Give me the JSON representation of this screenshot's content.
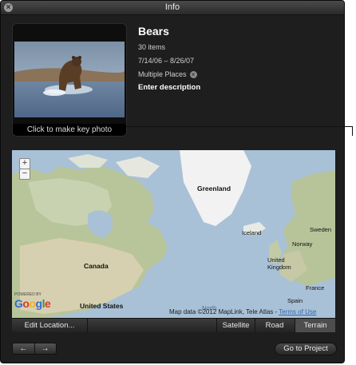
{
  "window": {
    "title": "Info"
  },
  "album": {
    "name": "Bears",
    "count": "30 items",
    "date_range": "7/14/06 – 8/26/07",
    "places": "Multiple Places",
    "description_prompt": "Enter description"
  },
  "photo": {
    "key_photo_label": "Click to make key photo"
  },
  "map": {
    "labels": {
      "greenland": "Greenland",
      "iceland": "Iceland",
      "canada": "Canada",
      "united_states": "United States",
      "sweden": "Sweden",
      "norway": "Norway",
      "united_kingdom": "United\nKingdom",
      "france": "France",
      "spain": "Spain",
      "north_atlantic": "North"
    },
    "powered_by": "POWERED BY",
    "provider": "Google",
    "attribution": "Map data ©2012 MapLink, Tele Atlas - ",
    "terms": "Terms of Use",
    "zoom_in": "+",
    "zoom_out": "−"
  },
  "toolbar": {
    "edit_location": "Edit Location...",
    "satellite": "Satellite",
    "road": "Road",
    "terrain": "Terrain",
    "active_view": "Terrain"
  },
  "footer": {
    "back_icon": "arrow-left-icon",
    "forward_icon": "arrow-right-icon",
    "go_to_project": "Go to Project"
  }
}
